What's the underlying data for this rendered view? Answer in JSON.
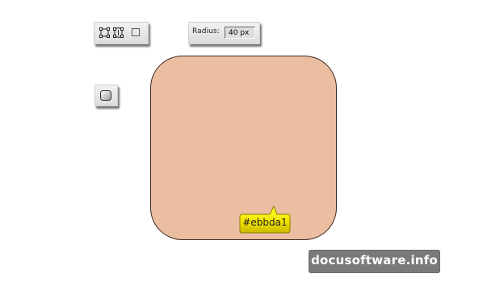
{
  "toolbar": {
    "modes": [
      {
        "name": "shape-layers-icon"
      },
      {
        "name": "paths-icon"
      },
      {
        "name": "fill-pixels-icon"
      }
    ],
    "radius": {
      "label": "Radius:",
      "value": "40 px"
    },
    "shape_tool_icon": "rounded-rectangle-tool-icon"
  },
  "canvas": {
    "shape_fill": "#ebbda1",
    "shape_type": "rounded rectangle"
  },
  "color_callout": {
    "text": "#ebbda1",
    "color": "#ffff00"
  },
  "watermark": {
    "text": "docusoftware.info"
  }
}
